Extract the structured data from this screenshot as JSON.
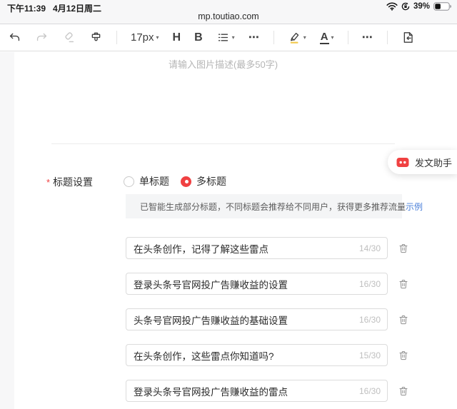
{
  "colors": {
    "accent_red": "#f04142",
    "link_blue": "#4a7fd9",
    "highlight_yellow": "#f2c94c"
  },
  "status_bar": {
    "time": "下午11:39",
    "date": "4月12日周二",
    "battery_percent": "39%",
    "url": "mp.toutiao.com"
  },
  "toolbar": {
    "font_size_label": "17px",
    "heading_label": "H",
    "bold_label": "B",
    "text_color_label": "A",
    "more_label": "⋯",
    "caret": "▾"
  },
  "editor": {
    "image_caption_placeholder": "请输入图片描述(最多50字)"
  },
  "assistant": {
    "label": "发文助手"
  },
  "title_settings": {
    "required_mark": "*",
    "label": "标题设置",
    "options": [
      {
        "label": "单标题",
        "selected": false
      },
      {
        "label": "多标题",
        "selected": true
      }
    ],
    "notice_text": "已智能生成部分标题，不同标题会推荐给不同用户，获得更多推荐流量",
    "notice_link": "示例",
    "titles": [
      {
        "value": "在头条创作，记得了解这些雷点",
        "counter": "14/30"
      },
      {
        "value": "登录头条号官网投广告赚收益的设置",
        "counter": "16/30"
      },
      {
        "value": "头条号官网投广告赚收益的基础设置",
        "counter": "16/30"
      },
      {
        "value": "在头条创作，这些雷点你知道吗?",
        "counter": "15/30"
      },
      {
        "value": "登录头条号官网投广告赚收益的雷点",
        "counter": "16/30"
      }
    ]
  }
}
